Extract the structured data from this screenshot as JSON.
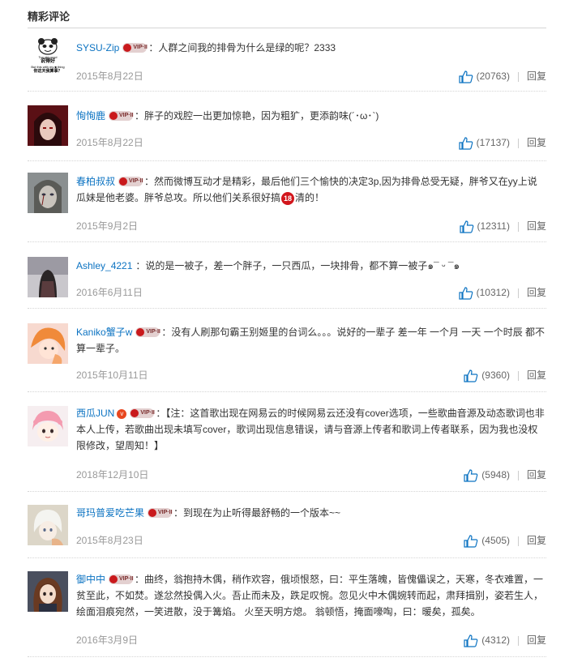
{
  "section_title": "精彩评论",
  "colors": {
    "accent": "#0c73c2",
    "date": "#999999",
    "text": "#333333"
  },
  "comments": [
    {
      "user": "SYSU-Zip",
      "vip": true,
      "badge": "",
      "content_parts": [
        "：人群之间我的排骨为什么是绿的呢？2333"
      ],
      "date": "2015年8月22日",
      "likes": "(20763)",
      "reply": "回复",
      "avatar_text": [
        "Too girl good",
        "说得好",
        "But this with my ■ thing",
        "你这天我算事？"
      ]
    },
    {
      "user": "恂恂鹿",
      "vip": true,
      "badge": "",
      "content_parts": [
        "：胖子的戏腔一出更加惊艳，因为粗犷，更添韵味(´･ω･`)"
      ],
      "date": "2015年8月22日",
      "likes": "(17137)",
      "reply": "回复"
    },
    {
      "user": "春柏叔叔",
      "vip": true,
      "badge": "",
      "content_parts": [
        "：然而微博互动才是精彩，最后他们三个愉快的决定3p,因为排骨总受无疑，胖爷又在yy上说瓜妹是他老婆。胖爷总攻。所以他们关系很好搞",
        "清的！"
      ],
      "sticker": "18",
      "date": "2015年9月2日",
      "likes": "(12311)",
      "reply": "回复"
    },
    {
      "user": "Ashley_4221",
      "vip": false,
      "badge": "",
      "content_parts": [
        "：说的是一被子，差一个胖子，一只西瓜，一块排骨，都不算一被子๑¯ ᵕ ¯๑"
      ],
      "date": "2016年6月11日",
      "likes": "(10312)",
      "reply": "回复"
    },
    {
      "user": "Kaniko蟹子w",
      "vip": true,
      "badge": "",
      "content_parts": [
        "：没有人刷那句霸王别姬里的台词么。。。说好的一辈子 差一年 一个月 一天 一个时辰 都不算一辈子。"
      ],
      "date": "2015年10月11日",
      "likes": "(9360)",
      "reply": "回复"
    },
    {
      "user": "西瓜JUN",
      "vip": true,
      "badge": "v",
      "content_parts": [
        "：【注：这首歌出现在网易云的时候网易云还没有cover选项，一些歌曲音源及动态歌词也非本人上传，若歌曲出现未填写cover，歌词出现信息错误，请与音源上传者和歌词上传者联系，因为我也没权限修改，望周知！】"
      ],
      "date": "2018年12月10日",
      "likes": "(5948)",
      "reply": "回复"
    },
    {
      "user": "哥玛普爱吃芒果",
      "vip": true,
      "badge": "",
      "content_parts": [
        "：到现在为止听得最舒畅的一个版本~~"
      ],
      "date": "2015年8月23日",
      "likes": "(4505)",
      "reply": "回复"
    },
    {
      "user": "御中中",
      "vip": true,
      "badge": "",
      "content_parts": [
        "：曲终，翁抱持木偶，稍作欢容，俄顷恨怒，曰：平生落魄，皆傀儡误之，天寒，冬衣难置，一贫至此，不如焚。遂忿然投偶入火。吾止而未及，跌足叹惋。忽见火中木偶婉转而起，肃拜揖别，姿若生人，绘面泪痕宛然，一笑进散，没于篝焰。 火至天明方熄。  翁顿悟，掩面嚎啕，曰：暖矣，孤矣。"
      ],
      "date": "2016年3月9日",
      "likes": "(4312)",
      "reply": "回复"
    }
  ]
}
